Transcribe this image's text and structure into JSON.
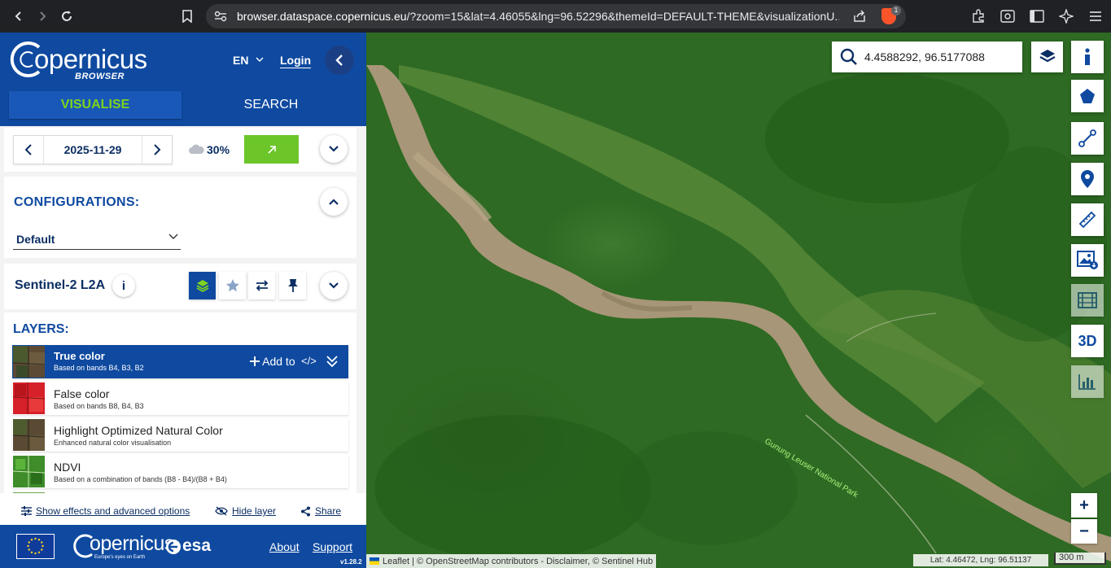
{
  "browser": {
    "url_host": "browser.dataspace.copernicus.eu",
    "url_rest": "/?zoom=15&lat=4.46055&lng=96.52296&themeId=DEFAULT-THEME&visualizationU...",
    "brave_badge": "1"
  },
  "header": {
    "logo_text": "opernicus",
    "logo_sub": "BROWSER",
    "language": "EN",
    "login": "Login",
    "tabs": [
      {
        "label": "VISUALISE",
        "active": true
      },
      {
        "label": "SEARCH",
        "active": false
      }
    ]
  },
  "date_panel": {
    "date": "2025-11-29",
    "cloud_coverage": "30%"
  },
  "configurations": {
    "title": "CONFIGURATIONS:",
    "selected": "Default"
  },
  "collection": {
    "name": "Sentinel-2 L2A",
    "info": "i"
  },
  "layers": {
    "title": "LAYERS:",
    "add_to": "Add to",
    "code": "</>",
    "items": [
      {
        "name": "True color",
        "description": "Based on bands B4, B3, B2",
        "selected": true
      },
      {
        "name": "False color",
        "description": "Based on bands B8, B4, B3",
        "selected": false
      },
      {
        "name": "Highlight Optimized Natural Color",
        "description": "Enhanced natural color visualisation",
        "selected": false
      },
      {
        "name": "NDVI",
        "description": "Based on a combination of bands (B8 - B4)/(B8 + B4)",
        "selected": false
      }
    ]
  },
  "bottom_links": {
    "effects": "Show effects and advanced options",
    "hide_layer": "Hide layer",
    "share": "Share"
  },
  "footer": {
    "copernicus": "opernicus",
    "copernicus_sub": "Europe's eyes on Earth",
    "esa": "esa",
    "about": "About",
    "support": "Support",
    "version": "v1.28.2"
  },
  "map": {
    "search_value": "4.4588292, 96.5177088",
    "park_label": "Gunung Leuser National Park",
    "attribution": "Leaflet | © OpenStreetMap contributors - Disclaimer, © Sentinel Hub",
    "coordinates": "Lat: 4.46472, Lng: 96.51137",
    "scale": "300 m",
    "tool_3d": "3D",
    "zoom_in": "+",
    "zoom_out": "−"
  },
  "colors": {
    "brand_blue": "#0f4aa0",
    "accent_green": "#6cc62a",
    "tab_active_text": "#7fd31d"
  }
}
